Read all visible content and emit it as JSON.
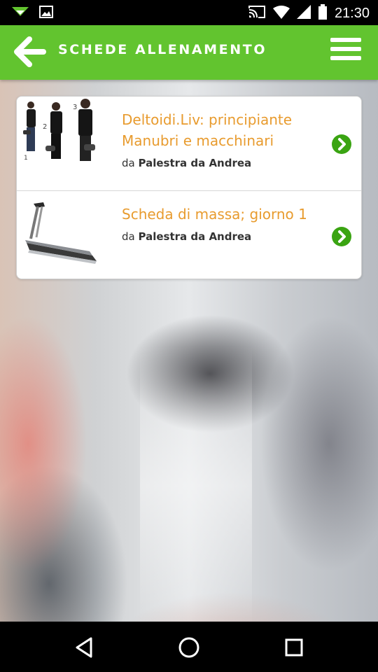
{
  "status_bar": {
    "time": "21:30",
    "icons": [
      "download-icon",
      "image-icon",
      "cast-icon",
      "wifi-icon",
      "signal-icon",
      "battery-icon"
    ]
  },
  "app_bar": {
    "title": "SCHEDE ALLENAMENTO",
    "icons": [
      "back-arrow-icon",
      "hamburger-menu-icon"
    ],
    "color": "#62c42f"
  },
  "workouts": [
    {
      "title_line1": "Deltoidi.Liv: principiante",
      "title_line2": "Manubri e macchinari",
      "by_prefix": "da",
      "author": "Palestra da Andrea",
      "thumbnail": "dumbbell-shrug-exercise-image",
      "action_icon": "chevron-right-circle-icon"
    },
    {
      "title_line1": "Scheda di massa; giorno 1",
      "by_prefix": "da",
      "author": "Palestra da Andrea",
      "thumbnail": "treadmill-image",
      "action_icon": "chevron-right-circle-icon"
    }
  ],
  "colors": {
    "title_orange": "#e89b2e",
    "accent_green": "#62c42f"
  },
  "nav_bar": {
    "icons": [
      "back-triangle-icon",
      "home-circle-icon",
      "recents-square-icon"
    ]
  }
}
